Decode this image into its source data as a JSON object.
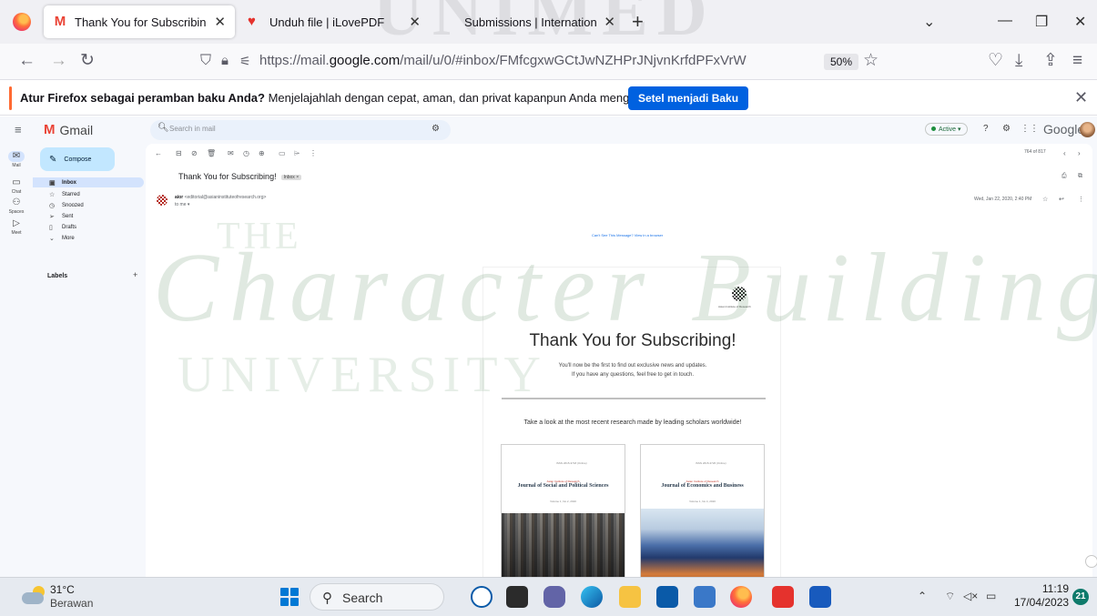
{
  "browser": {
    "tabs": [
      {
        "title": "Thank You for Subscribing! - erc",
        "icon": "gmail-icon",
        "active": true
      },
      {
        "title": "Unduh file | iLovePDF",
        "icon": "ilovepdf-heart-icon",
        "active": false
      },
      {
        "title": "Submissions | International Jour",
        "icon": "",
        "active": false
      }
    ],
    "url_prefix": "https://mail.",
    "url_domain": "google.com",
    "url_path": "/mail/u/0/#inbox/FMfcgxwGCtJwNZHPrJNjvnKrfdPFxVrW",
    "zoom": "50%"
  },
  "notification": {
    "bold": "Atur Firefox sebagai peramban baku Anda?",
    "text": " Menjelajahlah dengan cepat, aman, dan privat kapanpun Anda menggunakan Web.",
    "button": "Setel menjadi Baku"
  },
  "gmail": {
    "logo": "Gmail",
    "search_placeholder": "Search in mail",
    "status": "Active",
    "account_brand": "Google",
    "rail": [
      "Mail",
      "Chat",
      "Spaces",
      "Meet"
    ],
    "compose": "Compose",
    "nav": [
      "Inbox",
      "Starred",
      "Snoozed",
      "Sent",
      "Drafts",
      "More"
    ],
    "labels": "Labels",
    "pager": "764 of 817",
    "subject": "Thank You for Subscribing!",
    "subject_badge": "Inbox ×",
    "sender_name": "aior",
    "sender_email": "<editorial@asianinstituteofresearch.org>",
    "to": "to me ▾",
    "date": "Wed, Jan 22, 2020, 2:40 PM",
    "view_browser": "Can't See This Message? View in a browser"
  },
  "email": {
    "logo_caption": "Asian Institute of Research",
    "title": "Thank You for Subscribing!",
    "line1": "You'll now be the first to find out exclusive news and updates.",
    "line2": "If you have any questions, feel free to get in touch.",
    "promo": "Take a look at the most recent research made by leading scholars worldwide!",
    "journals": [
      {
        "small": "ISSN 2615-3718 (Online)",
        "publisher": "Asian Institute of Research",
        "name": "Journal of Social and Political Sciences",
        "volume": "Volume 1, No.2, 2020"
      },
      {
        "small": "ISSN 2615-3726 (Online)",
        "publisher": "Asian Institute of Research",
        "name": "Journal of Economics and Business",
        "volume": "Volume 1, No.4, 2020"
      }
    ]
  },
  "watermark": {
    "top": "UNIMED",
    "the": "THE",
    "script": "Character Building",
    "university": "UNIVERSITY"
  },
  "taskbar": {
    "temperature": "31°C",
    "condition": "Berawan",
    "search": "Search",
    "time": "11:19",
    "date": "17/04/2023",
    "notifications": "21"
  }
}
